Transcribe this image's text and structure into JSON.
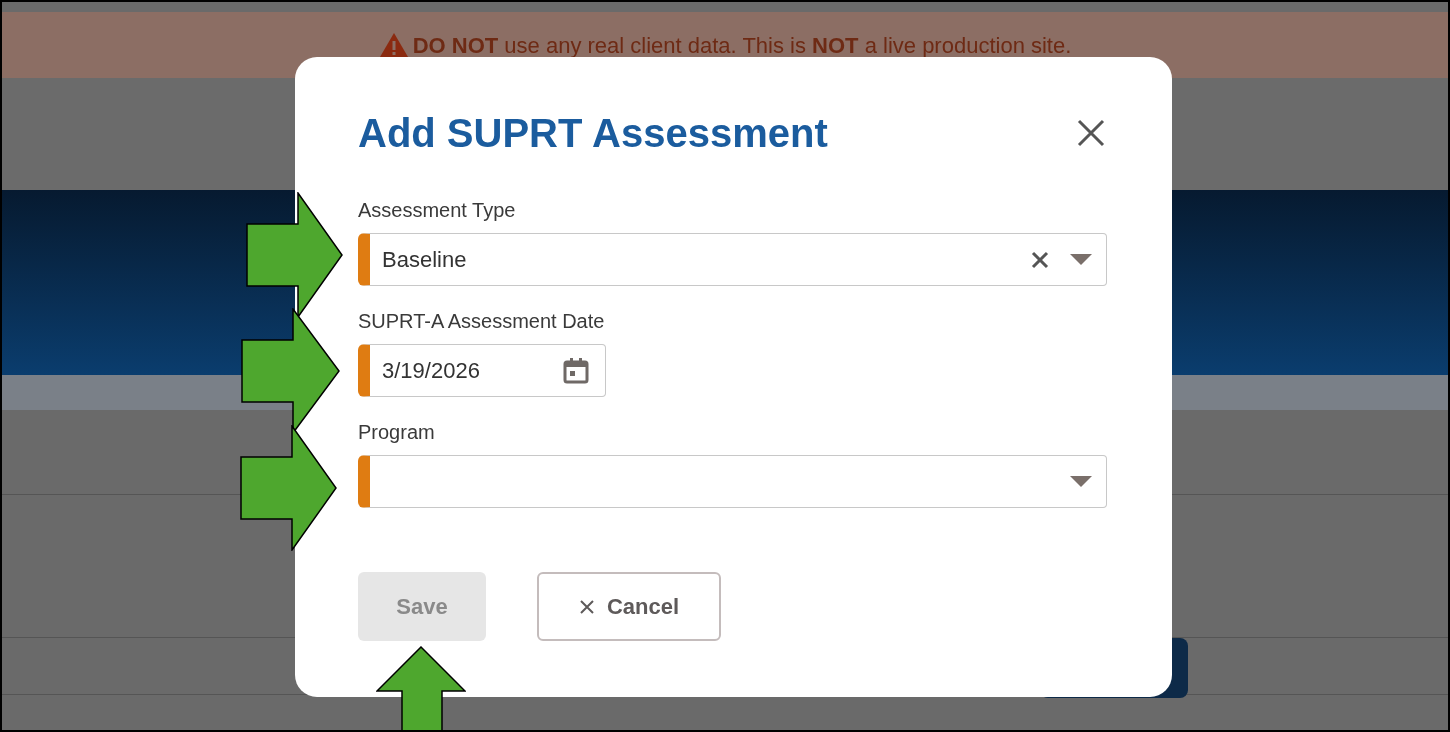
{
  "banner": {
    "text": "**DO NOT** use any real client data. This is **NOT** a live production site."
  },
  "dialog": {
    "title": "Add SUPRT Assessment",
    "fields": [
      {
        "kind": "select",
        "label": "Assessment Type",
        "value": "Baseline",
        "required": true,
        "clearable": true
      },
      {
        "kind": "date",
        "label": "SUPRT-A Assessment Date",
        "value": "3/19/2026",
        "required": true
      },
      {
        "kind": "select",
        "label": "Program",
        "required": true,
        "clearable": false
      }
    ],
    "buttons": [
      {
        "kind": "save",
        "label": "Save",
        "disabled": true
      },
      {
        "kind": "cancel",
        "label": "Cancel",
        "disabled": false
      }
    ]
  }
}
